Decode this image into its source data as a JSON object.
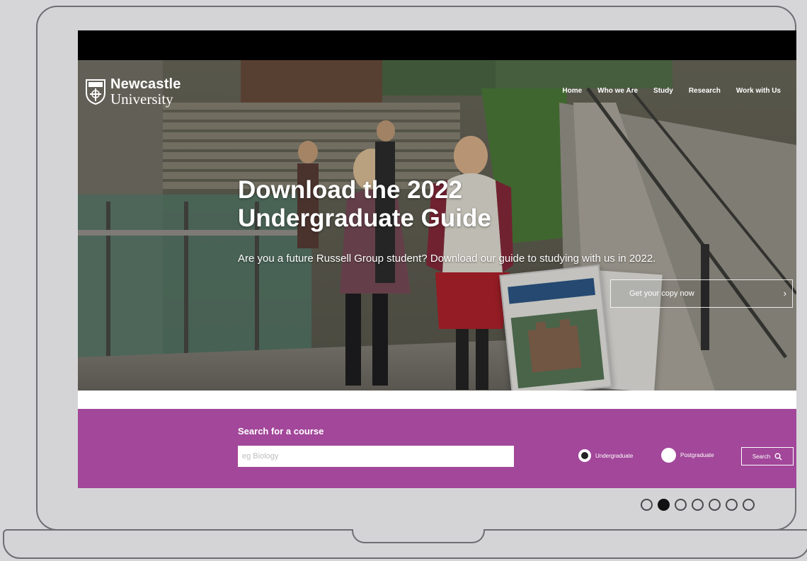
{
  "site": {
    "logo": {
      "line1": "Newcastle",
      "line2": "University"
    },
    "nav": [
      "Home",
      "Who we Are",
      "Study",
      "Research",
      "Work with Us"
    ]
  },
  "hero": {
    "title_line1": "Download the 2022",
    "title_line2": "Undergraduate Guide",
    "subtitle": "Are you a future Russell Group student? Download our guide to studying with us in 2022.",
    "cta_label": "Get your copy now",
    "cta_arrow": "›"
  },
  "search": {
    "heading": "Search for a course",
    "placeholder": "eg Biology",
    "options": [
      {
        "label": "Undergraduate",
        "checked": true
      },
      {
        "label": "Postgraduate",
        "checked": false
      }
    ],
    "button_label": "Search"
  },
  "carousel": {
    "total": 7,
    "active_index": 1
  },
  "colors": {
    "accent": "#a2479a",
    "laptop_outline": "#6e6e73",
    "background": "#d6d6d8"
  }
}
